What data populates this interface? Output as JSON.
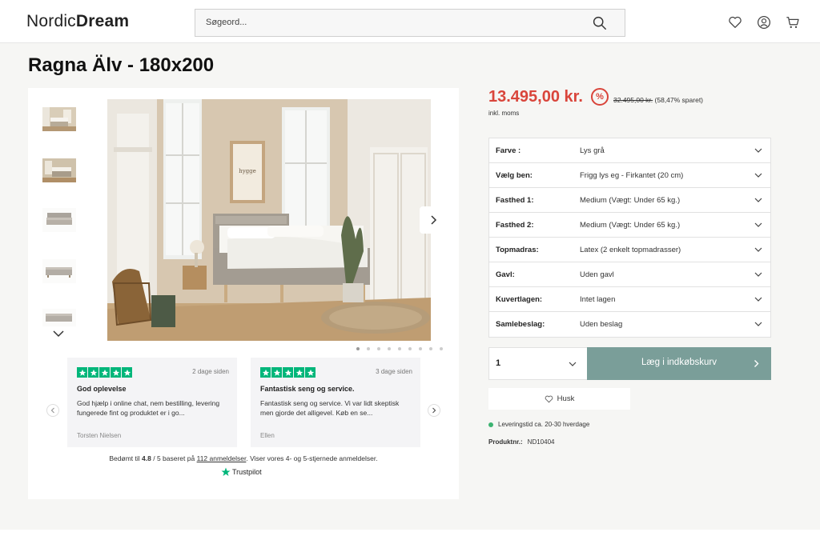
{
  "header": {
    "logo_light": "Nordic",
    "logo_bold": "Dream",
    "search_placeholder": "Søgeord...",
    "icons": [
      "search-icon",
      "heart-icon",
      "user-icon",
      "cart-icon"
    ]
  },
  "product": {
    "title": "Ragna Älv - 180x200",
    "price": "13.495,00 kr.",
    "discount_symbol": "%",
    "old_price": "32.495,00 kr.",
    "savings": "(58,47% sparet)",
    "vat_note": "inkl. moms",
    "options": [
      {
        "label": "Farve :",
        "value": "Lys grå"
      },
      {
        "label": "Vælg ben:",
        "value": "Frigg lys eg - Firkantet (20 cm)"
      },
      {
        "label": "Fasthed 1:",
        "value": "Medium (Vægt: Under 65 kg.)"
      },
      {
        "label": "Fasthed 2:",
        "value": "Medium (Vægt: Under 65 kg.)"
      },
      {
        "label": "Topmadras:",
        "value": "Latex (2 enkelt topmadrasser)"
      },
      {
        "label": "Gavl:",
        "value": "Uden gavl"
      },
      {
        "label": "Kuvertlagen:",
        "value": "Intet lagen"
      },
      {
        "label": "Samlebeslag:",
        "value": "Uden beslag"
      }
    ],
    "quantity": "1",
    "add_to_cart": "Læg i indkøbskurv",
    "wishlist": "Husk",
    "delivery": "Leveringstid ca. 20-30 hverdage",
    "product_number_label": "Produktnr.:",
    "product_number": "ND10404"
  },
  "gallery": {
    "image_wall_text": "hygge",
    "dots_total": 9,
    "dots_active": 1
  },
  "reviews": [
    {
      "title": "God oplevelse",
      "date": "2 dage siden",
      "body": "God hjælp i online chat, nem bestilling, levering fungerede fint og produktet er i go...",
      "author": "Torsten Nielsen",
      "stars": 5
    },
    {
      "title": "Fantastisk seng og service.",
      "date": "3 dage siden",
      "body": "Fantastisk seng og service. Vi var lidt skeptisk men gjorde det alligevel. Køb en se...",
      "author": "Ellen",
      "stars": 5
    }
  ],
  "trustpilot": {
    "prefix": "Bedømt til",
    "rating": "4.8",
    "middle": "/ 5 baseret på",
    "count": "112 anmeldelser",
    "suffix": ". Viser vores 4- og 5-stjernede anmeldelser.",
    "brand": "Trustpilot"
  },
  "colors": {
    "price_red": "#d9453b",
    "cart_button": "#7a9e99",
    "trustpilot_green": "#00b67a",
    "delivery_green": "#3cb371"
  }
}
